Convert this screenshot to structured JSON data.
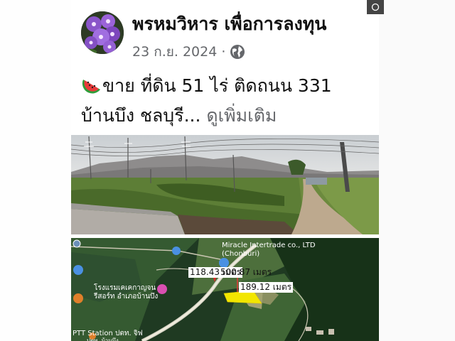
{
  "post": {
    "author": "พรหมวิหาร เพื่อการลงทุน",
    "date": "23 ก.ย. 2024",
    "separator": "·",
    "text_line1": "ขาย ที่ดิน 51 ไร่ ติดถนน 331",
    "text_line2": "บ้านบึง ชลบุรี...",
    "see_more": "ดูเพิ่มเติม"
  },
  "map": {
    "company_label": "Miracle Intertrade co., LTD (Chonburi)",
    "dimension_1": "118.43 เมตร",
    "dimension_2": "500.87 เมตร",
    "dimension_3": "189.12 เมตร",
    "place_label": "โรงแรมเคเคกาญจน รีสอร์ท อำเภอบ้านบึง",
    "station_label": "PTT Station ปตท. จิฟ",
    "station_sub": "ปตท. บ้านบึง"
  },
  "icons": {
    "avatar": "purple-flower-avatar",
    "privacy": "globe-icon",
    "emoji": "watermelon-icon",
    "corner": "circle-icon"
  },
  "colors": {
    "author": "#111111",
    "meta": "#65676b",
    "plot_highlight": "#f2e600",
    "map_dark": "#1f3a22"
  }
}
